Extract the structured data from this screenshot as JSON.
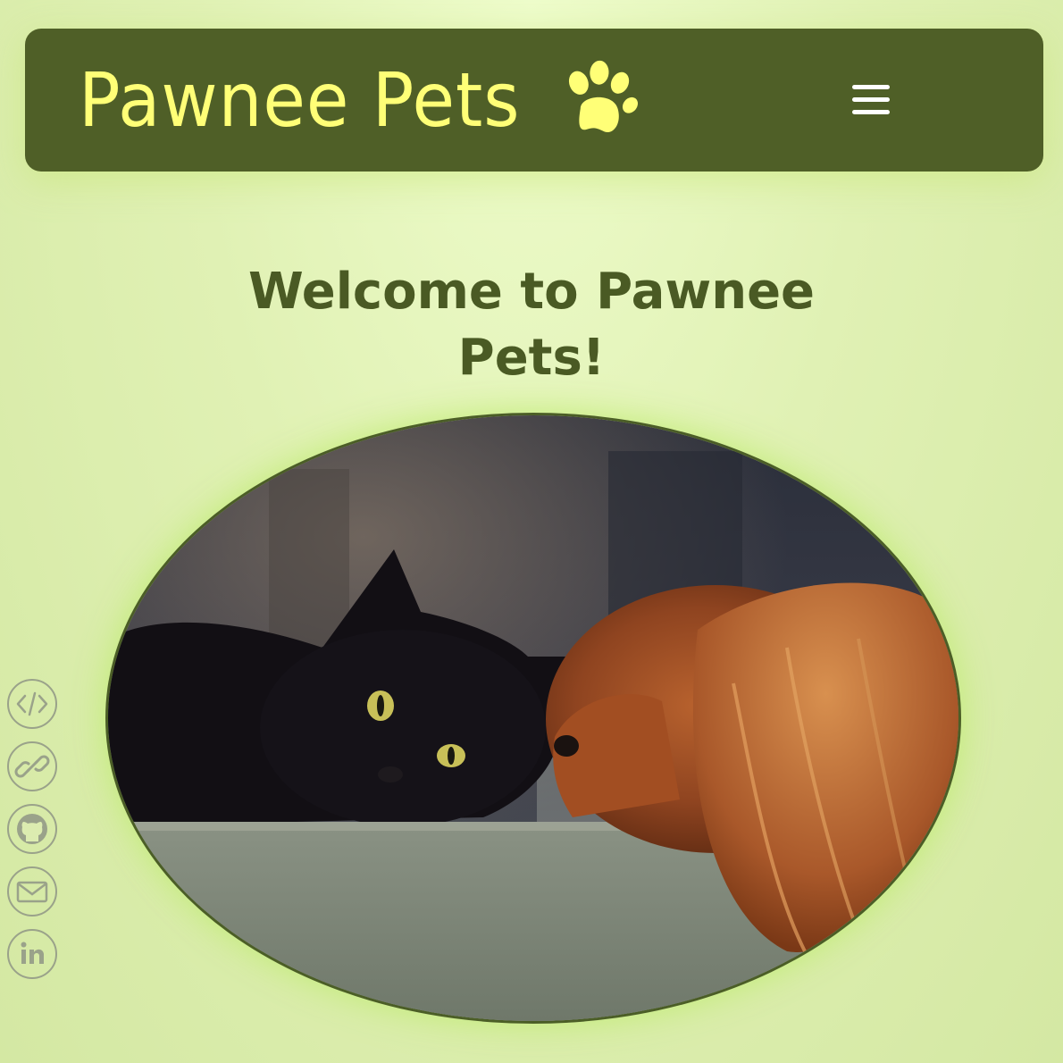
{
  "header": {
    "brand": "Pawnee Pets",
    "brand_icon": "paw-icon",
    "menu_icon": "hamburger-menu-icon"
  },
  "main": {
    "heading": "Welcome to Pawnee Pets!",
    "hero_image": "photo of a black cat and a cavalier spaniel resting on a ledge"
  },
  "social": [
    {
      "icon": "code-icon"
    },
    {
      "icon": "link-icon"
    },
    {
      "icon": "github-icon"
    },
    {
      "icon": "email-icon"
    },
    {
      "icon": "linkedin-icon"
    }
  ],
  "colors": {
    "navbar": "#4f5f27",
    "brand": "#ffff77",
    "heading": "#4a5a24",
    "background": "#e0f1b4",
    "social_outline": "#9aa28a"
  }
}
